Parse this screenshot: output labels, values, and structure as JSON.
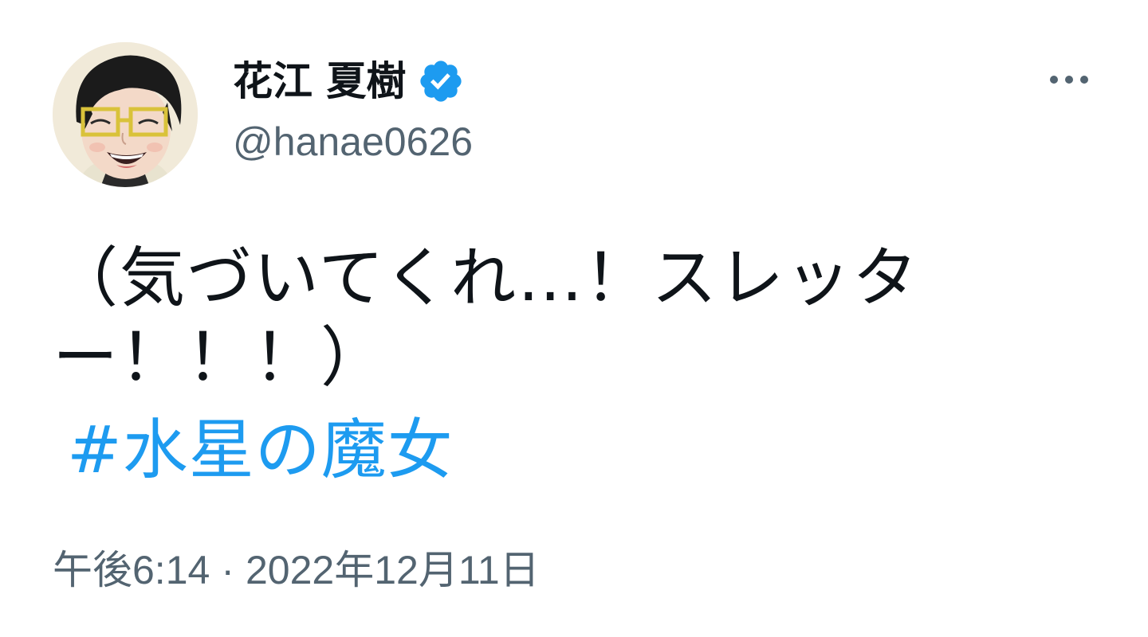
{
  "author": {
    "display_name": "花江 夏樹",
    "handle": "@hanae0626",
    "verified": true,
    "avatar": "avatar-illustration"
  },
  "tweet": {
    "text_lines": [
      "（気づいてくれ…！スレッタ",
      "ー！！！）"
    ],
    "hashtag": "#水星の魔女",
    "time": "午後6:14",
    "separator": "·",
    "date": "2022年12月11日"
  },
  "icons": {
    "verified": "verified-badge-icon",
    "more": "more-horizontal-icon"
  },
  "colors": {
    "text": "#0f1419",
    "secondary_text": "#536471",
    "link": "#1d9bf0",
    "verified_badge": "#1d9bf0",
    "background": "#ffffff"
  }
}
